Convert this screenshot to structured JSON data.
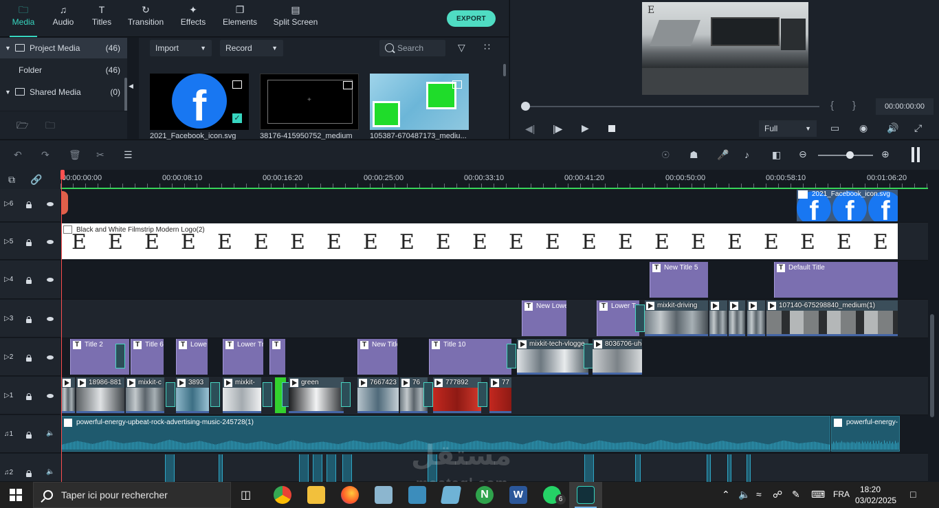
{
  "tabs": [
    {
      "label": "Media",
      "icon": "folder-icon"
    },
    {
      "label": "Audio",
      "icon": "music-icon"
    },
    {
      "label": "Titles",
      "icon": "text-icon"
    },
    {
      "label": "Transition",
      "icon": "transition-icon"
    },
    {
      "label": "Effects",
      "icon": "effects-icon"
    },
    {
      "label": "Elements",
      "icon": "elements-icon"
    },
    {
      "label": "Split Screen",
      "icon": "split-screen-icon"
    }
  ],
  "export_label": "EXPORT",
  "media_tree": {
    "items": [
      {
        "label": "Project Media",
        "count": "(46)"
      },
      {
        "label": "Folder",
        "count": "(46)"
      },
      {
        "label": "Shared Media",
        "count": "(0)"
      }
    ]
  },
  "media_toolbar": {
    "import_label": "Import",
    "record_label": "Record",
    "search_placeholder": "Search"
  },
  "media_items": [
    {
      "name": "2021_Facebook_icon.svg"
    },
    {
      "name": "38176-415950752_medium"
    },
    {
      "name": "105387-670487173_mediu..."
    }
  ],
  "preview": {
    "timecode": "00:00:00:00",
    "quality": "Full",
    "brace_open": "{",
    "brace_close": "}",
    "watermark_letter": "E"
  },
  "ruler": {
    "labels": [
      "00:00:00:00",
      "00:00:08:10",
      "00:00:16:20",
      "00:00:25:00",
      "00:00:33:10",
      "00:00:41:20",
      "00:00:50:00",
      "00:00:58:10",
      "00:01:06:20"
    ]
  },
  "tracks": {
    "v6": "6",
    "v5": "5",
    "v4": "4",
    "v3": "3",
    "v2": "2",
    "v1": "1",
    "a1": "1",
    "a2": "2"
  },
  "clips": {
    "fb_clip": "2021_Facebook_icon.svg",
    "filmstrip": "Black and White Filmstrip Modern Logo(2)",
    "filmstrip_letter": "E",
    "t4_a": "New Title 5",
    "t4_b": "Default Title",
    "t3_a": "New Lowe",
    "t3_b": "Lower T",
    "t3_c": "mixkit-driving",
    "t3_d": "107140-675298840_medium(1)",
    "t2_a": "Title 2",
    "t2_b": "Title 6",
    "t2_c": "Lowe",
    "t2_d": "Lower Tr",
    "t2_e": "New Title",
    "t2_f": "Title 10",
    "t2_g": "mixkit-tech-vlogge",
    "t2_h": "8036706-uhd",
    "t1_a": "18986-881",
    "t1_b": "mixkit-c",
    "t1_c": "3893",
    "t1_d": "mixkit-",
    "t1_e": "green",
    "t1_f": "7667423",
    "t1_g": "76",
    "t1_h": "777892",
    "t1_i": "77",
    "audio_a": "powerful-energy-upbeat-rock-advertising-music-245728(1)",
    "audio_b": "powerful-energy-"
  },
  "taskbar": {
    "search_placeholder": "Taper ici pour rechercher",
    "time": "18:20",
    "date": "03/02/2025",
    "language": "FRA",
    "whatsapp_badge": "6"
  },
  "watermark": {
    "arabic": "مستقل",
    "latin": "mostaql.com"
  },
  "colors": {
    "accent": "#37d6c0",
    "title_clip": "#7b6fb0",
    "audio_clip": "#1f5a6e",
    "playhead": "#ff5050"
  }
}
